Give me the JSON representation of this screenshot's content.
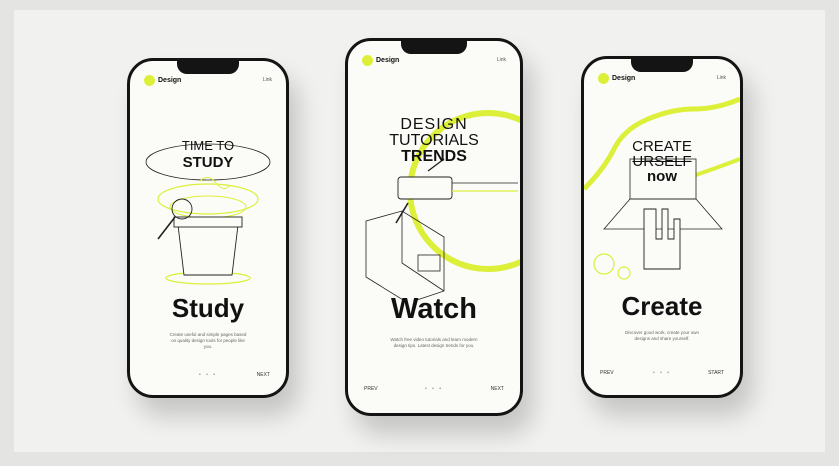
{
  "colors": {
    "accent": "#dcf03a",
    "ink": "#111111",
    "background": "#f1f1ef"
  },
  "screens": [
    {
      "brand": "Design",
      "menu": "Link",
      "headline_1": "TIME TO",
      "headline_2": "STUDY",
      "title": "Study",
      "description": "Create useful and simple pages based on quality design tools for people like you.",
      "prev": "",
      "pager": "• • •",
      "next": "NEXT"
    },
    {
      "brand": "Design",
      "menu": "Link",
      "headline_1": "DESIGN",
      "headline_2": "TUTORIALS",
      "headline_3": "TRENDS",
      "title": "Watch",
      "description": "Watch free video tutorials and learn modern design tips. Latest design trends for you.",
      "prev": "PREV",
      "pager": "• • •",
      "next": "NEXT"
    },
    {
      "brand": "Design",
      "menu": "Link",
      "headline_1": "CREATE",
      "headline_2": "URSELF",
      "headline_3": "now",
      "title": "Create",
      "description": "Discover good work, create your own designs and share yourself.",
      "prev": "PREV",
      "pager": "• • •",
      "next": "START"
    }
  ]
}
